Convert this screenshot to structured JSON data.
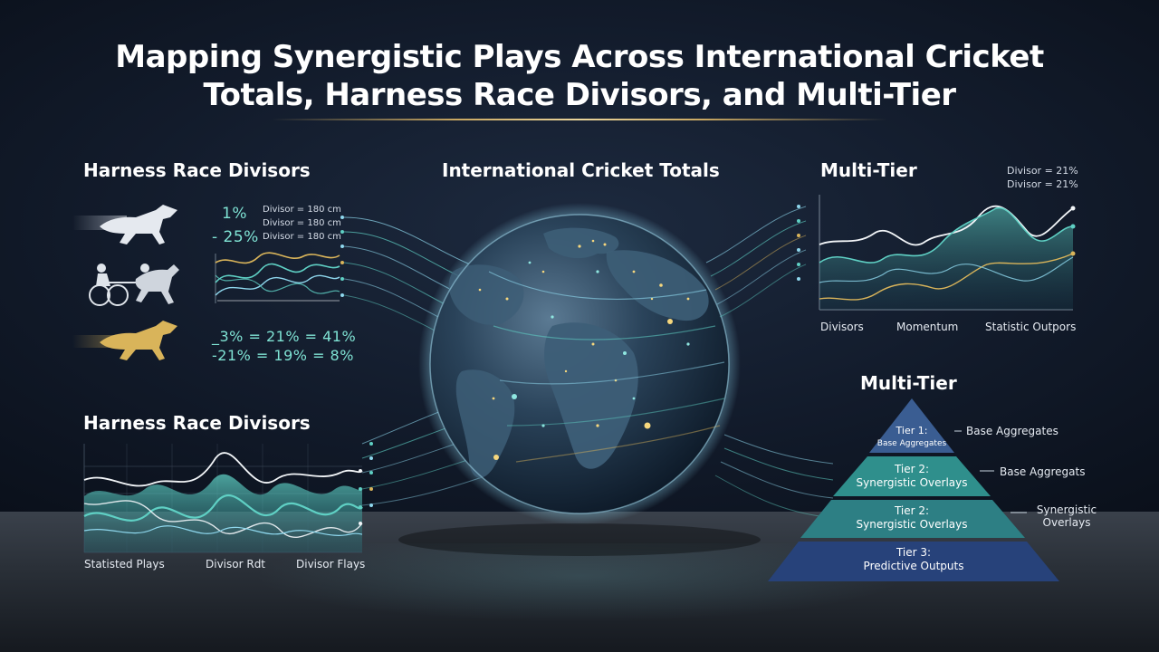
{
  "title": {
    "line1": "Mapping Synergistic Plays Across International Cricket",
    "line2": "Totals, Harness Race Divisors, and Multi-Tier"
  },
  "left_top": {
    "heading": "Harness Race Divisors",
    "big_stats": [
      "1%",
      "- 25%"
    ],
    "divisor_lines": [
      "Divisor = 180 cm",
      "Divisor = 180 cm",
      "Divisor = 180 cm"
    ],
    "lower_stats": [
      "_3% = 21% = 41%",
      "-21% = 19% = 8%"
    ]
  },
  "left_bottom": {
    "heading": "Harness Race Divisors",
    "x_labels": [
      "Statisted Plays",
      "Divisor Rdt",
      "Divisor Flays"
    ]
  },
  "center": {
    "heading": "International Cricket Totals"
  },
  "right_top": {
    "heading": "Multi-Tier",
    "notes": [
      "Divisor = 21%",
      "Divisor = 21%"
    ],
    "x_labels": [
      "Divisors",
      "Momentum",
      "Statistic Outpors"
    ]
  },
  "pyramid": {
    "heading": "Multi-Tier",
    "tiers": [
      {
        "line1": "Tier 1:",
        "line2": "Base Aggregates"
      },
      {
        "line1": "Tier 2:",
        "line2": "Synergistic Overlays"
      },
      {
        "line1": "Tier 2:",
        "line2": "Synergistic Overlays"
      },
      {
        "line1": "Tier 3:",
        "line2": "Predictive Outputs"
      }
    ],
    "side_labels": [
      "Base Aggregates",
      "Base Aggregats",
      "Synergistic Overlays"
    ]
  },
  "colors": {
    "teal": "#5fd0c4",
    "cyan": "#8fd8ee",
    "gold": "#d9b45a",
    "white": "#f2f5f8",
    "pyramid_top": "#3a5d92",
    "pyramid_mid": "#2f8f8c",
    "pyramid_low": "#2d7f84",
    "pyramid_base": "#27427a"
  }
}
